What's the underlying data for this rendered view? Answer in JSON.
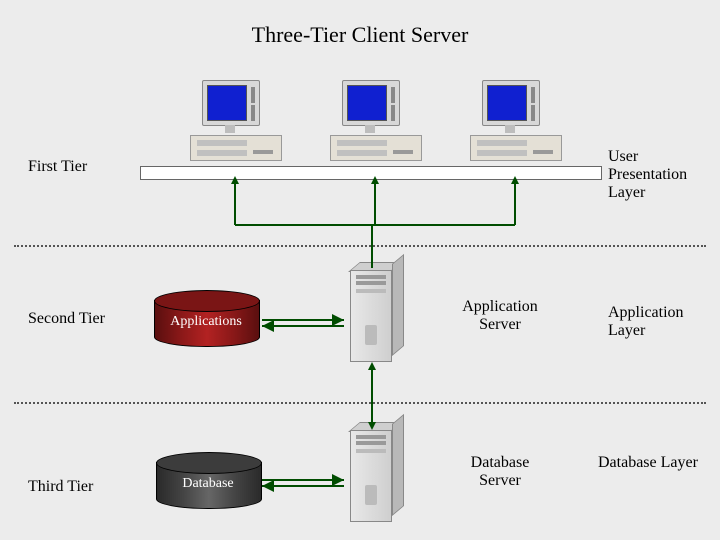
{
  "title": "Three-Tier Client Server",
  "tiers": {
    "first": "First Tier",
    "second": "Second Tier",
    "third": "Third Tier"
  },
  "layers": {
    "user": "User\nPresentation\nLayer",
    "app": "Application\nLayer",
    "db": "Database Layer"
  },
  "cylinders": {
    "applications": "Applications",
    "database": "Database"
  },
  "nodes": {
    "app_server": "Application\nServer",
    "db_server": "Database\nServer"
  },
  "colors": {
    "app_cylinder": "#8a1818",
    "db_cylinder": "#444444",
    "screen": "#1020d0",
    "arrow": "#004d00"
  }
}
